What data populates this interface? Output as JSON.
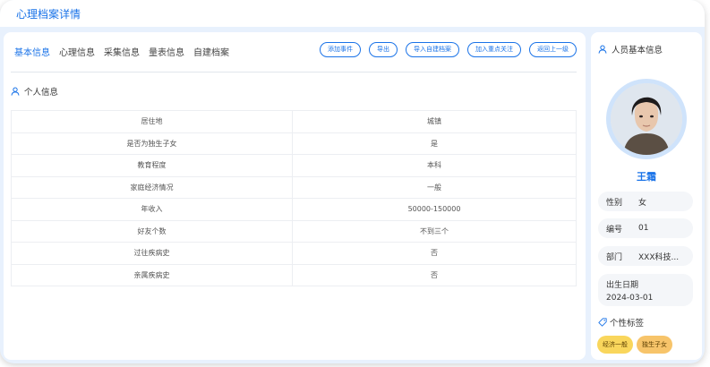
{
  "page": {
    "title": "心理档案详情"
  },
  "tabs": [
    {
      "label": "基本信息",
      "active": true
    },
    {
      "label": "心理信息",
      "active": false
    },
    {
      "label": "采集信息",
      "active": false
    },
    {
      "label": "量表信息",
      "active": false
    },
    {
      "label": "自建档案",
      "active": false
    }
  ],
  "actions": {
    "add_event": "添加事件",
    "export": "导出",
    "import_archive": "导入自建档案",
    "add_focus": "加入重点关注",
    "back": "返回上一级"
  },
  "personal": {
    "title": "个人信息",
    "rows": [
      {
        "key": "居住地",
        "value": "城镇"
      },
      {
        "key": "是否为独生子女",
        "value": "是"
      },
      {
        "key": "教育程度",
        "value": "本科"
      },
      {
        "key": "家庭经济情况",
        "value": "一般"
      },
      {
        "key": "年收入",
        "value": "50000-150000"
      },
      {
        "key": "好友个数",
        "value": "不到三个"
      },
      {
        "key": "过往疾病史",
        "value": "否"
      },
      {
        "key": "亲属疾病史",
        "value": "否"
      }
    ]
  },
  "profile": {
    "title": "人员基本信息",
    "name": "王霜",
    "gender_label": "性别",
    "gender": "女",
    "id_label": "编号",
    "id": "01",
    "dept_label": "部门",
    "dept": "XXX科技...",
    "birth_label": "出生日期",
    "birth": "2024-03-01",
    "tags_title": "个性标签",
    "tags": [
      "经济一般",
      "独生子女"
    ]
  },
  "colors": {
    "accent": "#1a73e8",
    "tag": "#f9d65c",
    "background": "#e8f1fd"
  }
}
